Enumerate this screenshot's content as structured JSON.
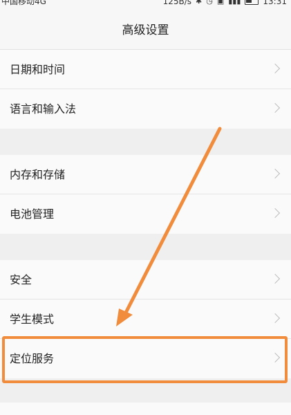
{
  "status_bar": {
    "carrier": "中国移动4G",
    "speed": "125B/s",
    "time": "13:31"
  },
  "header": {
    "title": "高级设置"
  },
  "groups": [
    {
      "items": [
        {
          "label": "日期和时间"
        },
        {
          "label": "语言和输入法"
        }
      ]
    },
    {
      "items": [
        {
          "label": "内存和存储"
        },
        {
          "label": "电池管理"
        }
      ]
    },
    {
      "items": [
        {
          "label": "安全"
        },
        {
          "label": "学生模式"
        },
        {
          "label": "定位服务"
        }
      ]
    }
  ],
  "annotation": {
    "highlight_color": "#f08c3c",
    "highlighted_item": "定位服务"
  }
}
